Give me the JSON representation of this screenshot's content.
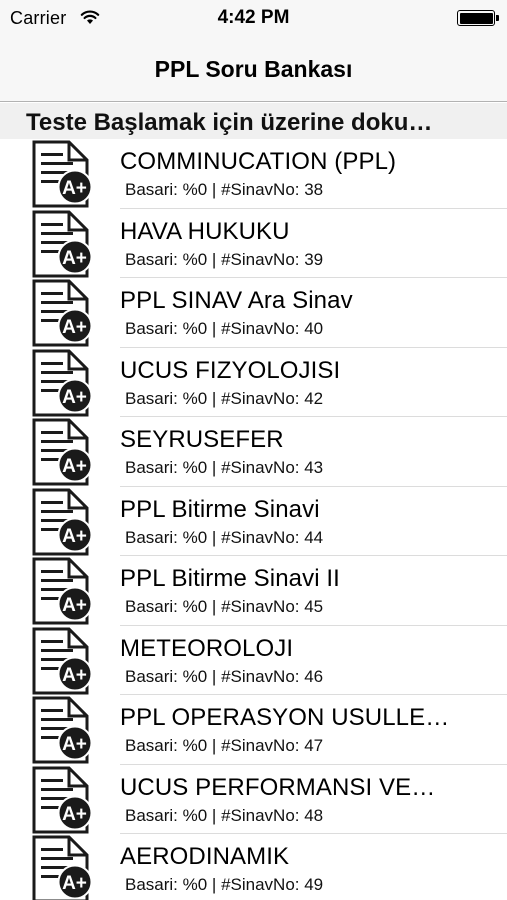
{
  "status_bar": {
    "carrier": "Carrier",
    "time": "4:42 PM",
    "battery_level": 1.0
  },
  "nav": {
    "title": "PPL Soru Bankası"
  },
  "section": {
    "header": "Teste Başlamak için üzerine doku…"
  },
  "list": {
    "icon": "document-grade-a-plus-icon",
    "items": [
      {
        "title": "COMMINUCATION (PPL)",
        "subtitle": "Basari: %0 |  #SinavNo: 38"
      },
      {
        "title": "HAVA HUKUKU",
        "subtitle": "Basari: %0 |  #SinavNo: 39"
      },
      {
        "title": "PPL SINAV Ara Sinav",
        "subtitle": "Basari: %0 |  #SinavNo: 40"
      },
      {
        "title": "UCUS FIZYOLOJISI",
        "subtitle": "Basari: %0 |  #SinavNo: 42"
      },
      {
        "title": "SEYRUSEFER",
        "subtitle": "Basari: %0 |  #SinavNo: 43"
      },
      {
        "title": "PPL Bitirme Sinavi",
        "subtitle": "Basari: %0 |  #SinavNo: 44"
      },
      {
        "title": "PPL Bitirme Sinavi II",
        "subtitle": "Basari: %0 |  #SinavNo: 45"
      },
      {
        "title": "METEOROLOJI",
        "subtitle": "Basari: %0 |  #SinavNo: 46"
      },
      {
        "title": "PPL OPERASYON USULLE…",
        "subtitle": "Basari: %0 |  #SinavNo: 47"
      },
      {
        "title": "UCUS PERFORMANSI VE…",
        "subtitle": "Basari: %0 |  #SinavNo: 48"
      },
      {
        "title": "AERODINAMIK",
        "subtitle": "Basari: %0 |  #SinavNo: 49"
      }
    ]
  },
  "colors": {
    "bar_background": "#f7f7f7",
    "section_background": "#f0f0f0",
    "separator": "#dcdcdc",
    "icon_badge": "#1a1a1a"
  }
}
